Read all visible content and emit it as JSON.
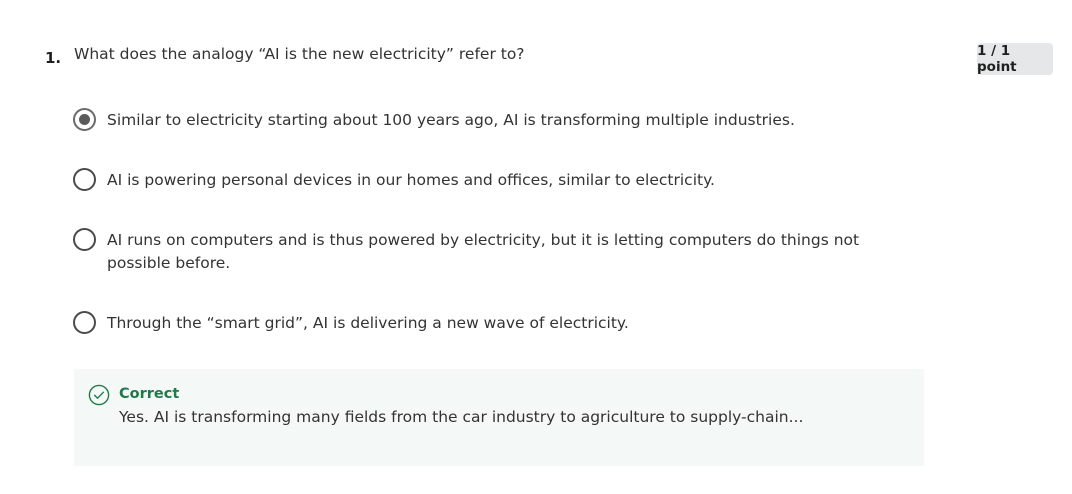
{
  "question": {
    "number": "1.",
    "text": "What does the analogy “AI is the new electricity” refer to?",
    "points": "1 / 1 point"
  },
  "options": [
    {
      "label": "Similar to electricity starting about 100 years ago, AI is transforming multiple industries.",
      "selected": true
    },
    {
      "label": "AI is powering personal devices in our homes and offices, similar to electricity.",
      "selected": false
    },
    {
      "label": "AI runs on computers and is thus powered by electricity, but it is letting computers do things not possible before.",
      "selected": false
    },
    {
      "label": "Through the “smart grid”, AI is delivering a new wave of electricity.",
      "selected": false
    }
  ],
  "feedback": {
    "status": "Correct",
    "icon": "check-circle-icon",
    "text": "Yes. AI is transforming many fields from the car industry to agriculture to supply-chain...",
    "accent_color": "#1f7a4a"
  }
}
